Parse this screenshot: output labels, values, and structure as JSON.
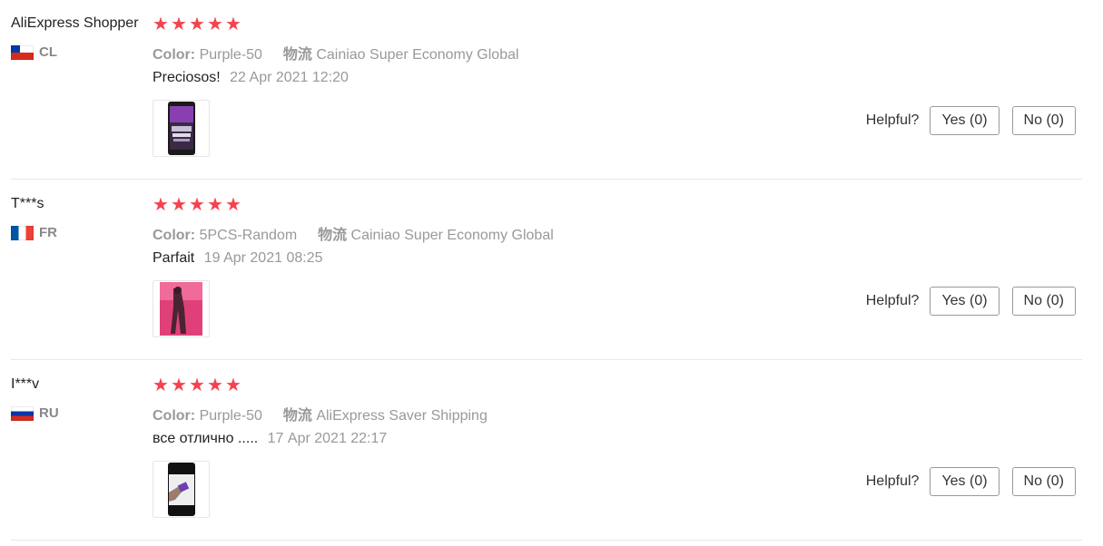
{
  "reviews": [
    {
      "user": "AliExpress Shopper",
      "country": "CL",
      "rating": 5,
      "color_label": "Color:",
      "color_value": "Purple-50",
      "shipping_label": "物流",
      "shipping_value": "Cainiao Super Economy Global",
      "text": "Preciosos!",
      "date": "22 Apr 2021 12:20",
      "helpful_label": "Helpful?",
      "yes_label": "Yes (0)",
      "no_label": "No (0)"
    },
    {
      "user": "T***s",
      "country": "FR",
      "rating": 5,
      "color_label": "Color:",
      "color_value": "5PCS-Random",
      "shipping_label": "物流",
      "shipping_value": "Cainiao Super Economy Global",
      "text": "Parfait",
      "date": "19 Apr 2021 08:25",
      "helpful_label": "Helpful?",
      "yes_label": "Yes (0)",
      "no_label": "No (0)"
    },
    {
      "user": "I***v",
      "country": "RU",
      "rating": 5,
      "color_label": "Color:",
      "color_value": "Purple-50",
      "shipping_label": "物流",
      "shipping_value": "AliExpress Saver Shipping",
      "text": "все отлично .....",
      "date": "17 Apr 2021 22:17",
      "helpful_label": "Helpful?",
      "yes_label": "Yes (0)",
      "no_label": "No (0)"
    }
  ],
  "icons": {
    "star": "star-icon",
    "flags": [
      "chile-flag-icon",
      "france-flag-icon",
      "russia-flag-icon"
    ]
  },
  "colors": {
    "star": "#f5424f",
    "muted_text": "#999999",
    "divider": "#e8e8e8"
  }
}
